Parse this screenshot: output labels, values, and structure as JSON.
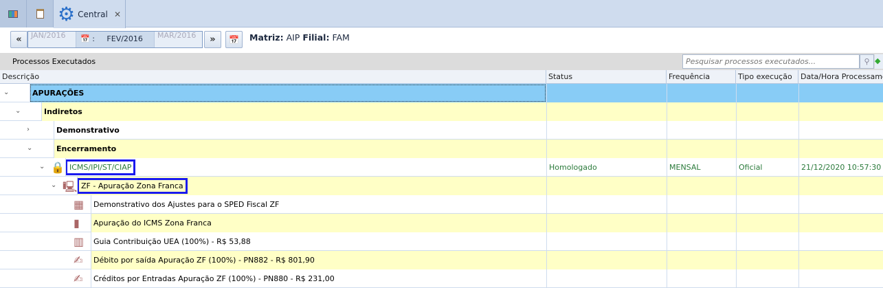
{
  "tabs": {
    "active_label": "Central",
    "close": "✕"
  },
  "toolbar": {
    "prev": "«",
    "next": "»",
    "period_prev": "JAN/2016",
    "period_current": "FEV/2016",
    "period_next": "MAR/2016",
    "period_sep": ":",
    "matriz_label": "Matriz:",
    "matriz_value": "AIP",
    "filial_label": "Filial:",
    "filial_value": "FAM"
  },
  "panel": {
    "title": "Processos Executados",
    "search_placeholder": "Pesquisar processos executados..."
  },
  "columns": [
    "Descrição",
    "Status",
    "Frequência",
    "Tipo execução",
    "Data/Hora Processamento"
  ],
  "rows": [
    {
      "label": "APURAÇÕES"
    },
    {
      "label": "Indiretos"
    },
    {
      "label": "Demonstrativo"
    },
    {
      "label": "Encerramento"
    },
    {
      "label": "ICMS/IPI/ST/CIAP",
      "status": "Homologado",
      "freq": "MENSAL",
      "tipo": "Oficial",
      "data": "21/12/2020 10:57:30"
    },
    {
      "label": "ZF - Apuração Zona Franca"
    },
    {
      "label": "Demonstrativo dos Ajustes para o SPED Fiscal ZF"
    },
    {
      "label": "Apuração do ICMS Zona Franca"
    },
    {
      "label": "Guia Contribuição UEA (100%) - R$ 53,88"
    },
    {
      "label": "Débito por saída Apuração ZF (100%) - PN882 - R$ 801,90"
    },
    {
      "label": "Créditos por Entradas Apuração ZF (100%) - PN880 - R$ 231,00"
    }
  ],
  "colors": {
    "selected": "#88ccf6",
    "alt_row": "#ffffc6",
    "status_green": "#2a7a3a",
    "highlight": "#1a1aee"
  }
}
